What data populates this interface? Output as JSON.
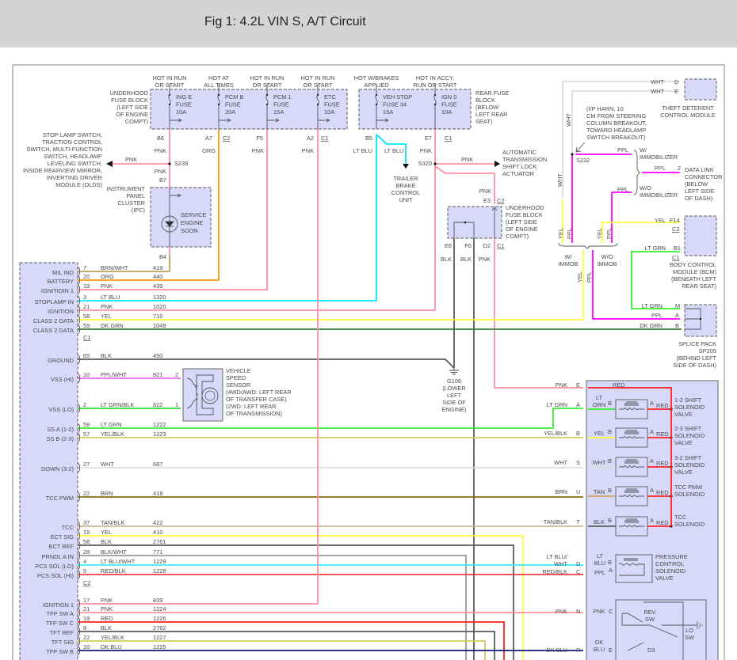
{
  "header": {
    "title": "Fig 1: 4.2L VIN S, A/T Circuit"
  },
  "wire_colors": {
    "PNK": "#ff8fa3",
    "ORG": "#ff9900",
    "BRN/WHT": "#b8a060",
    "LT BLU": "#00e5ff",
    "YEL": "#ffff33",
    "DK GRN": "#2e7d32",
    "BLK": "#5a5a5a",
    "PPL/WHT": "#ee66ee",
    "LT GRN/BLK": "#33dd33",
    "LT GRN": "#33ee33",
    "YEL/BLK": "#d4cc55",
    "WHT": "#dddddd",
    "BRN": "#8b6914",
    "TAN/BLK": "#c8b898",
    "BLK/WHT": "#999999",
    "LT BLU/WHT": "#33eeff",
    "RED/BLK": "#e84040",
    "RED": "#ff2020",
    "DK BLU": "#0a1a80",
    "PPL": "#ff00ff",
    "TAN": "#c8a060"
  },
  "pcm": {
    "connector_c1": "C1",
    "connector_c2": "C2",
    "rows": [
      {
        "label": "MIL IND",
        "pin": "7",
        "wire": "BRN/WHT",
        "circuit": "419"
      },
      {
        "label": "BATTERY",
        "pin": "20",
        "wire": "ORG",
        "circuit": "440"
      },
      {
        "label": "IGNITIOIN 1",
        "pin": "19",
        "wire": "PNK",
        "circuit": "439"
      },
      {
        "label": "STOPLAMP IN",
        "pin": "3",
        "wire": "LT BLU",
        "circuit": "1320"
      },
      {
        "label": "IGNITION",
        "pin": "21",
        "wire": "PNK",
        "circuit": "1020"
      },
      {
        "label": "CLASS 2 DATA",
        "pin": "58",
        "wire": "YEL",
        "circuit": "710"
      },
      {
        "label": "CLASS 2 DATA",
        "pin": "59",
        "wire": "DK GRN",
        "circuit": "1049"
      },
      {
        "label": "GROUND",
        "pin": "65",
        "wire": "BLK",
        "circuit": "450"
      },
      {
        "label": "VSS (HI)",
        "pin": "10",
        "wire": "PPL/WHT",
        "circuit": "821"
      },
      {
        "label": "VSS (LO)",
        "pin": "2",
        "wire": "LT GRN/BLK",
        "circuit": "822"
      },
      {
        "label": "SS A (1-2)",
        "pin": "59",
        "wire": "LT GRN",
        "circuit": "1222"
      },
      {
        "label": "SS B (2-3)",
        "pin": "57",
        "wire": "YEL/BLK",
        "circuit": "1223"
      },
      {
        "label": "DOWN (3-2)",
        "pin": "27",
        "wire": "WHT",
        "circuit": "687"
      },
      {
        "label": "TCC PWM",
        "pin": "22",
        "wire": "BRN",
        "circuit": "418"
      },
      {
        "label": "TCC",
        "pin": "37",
        "wire": "TAN/BLK",
        "circuit": "422"
      },
      {
        "label": "ECT SIG",
        "pin": "19",
        "wire": "YEL",
        "circuit": "410"
      },
      {
        "label": "ECT REF",
        "pin": "58",
        "wire": "BLK",
        "circuit": "2761"
      },
      {
        "label": "PRNDL A IN",
        "pin": "28",
        "wire": "BLK/WHT",
        "circuit": "771"
      },
      {
        "label": "PCS SOL (LO)",
        "pin": "4",
        "wire": "LT BLU/WHT",
        "circuit": "1229"
      },
      {
        "label": "PCS SOL (HI)",
        "pin": "5",
        "wire": "RED/BLK",
        "circuit": "1228"
      },
      {
        "label": "IGNITION 1",
        "pin": "17",
        "wire": "PNK",
        "circuit": "839"
      },
      {
        "label": "TFP SW A",
        "pin": "21",
        "wire": "PNK",
        "circuit": "1224"
      },
      {
        "label": "TFP SW C",
        "pin": "19",
        "wire": "RED",
        "circuit": "1226"
      },
      {
        "label": "TFT REF",
        "pin": "8",
        "wire": "BLK",
        "circuit": "2762"
      },
      {
        "label": "TFT SIG",
        "pin": "22",
        "wire": "YEL/BLK",
        "circuit": "1227"
      },
      {
        "label": "TFP SW B",
        "pin": "10",
        "wire": "DK BLU",
        "circuit": "1225"
      }
    ]
  },
  "underhood_block": {
    "location": [
      "UNDERHOOD",
      "FUSE BLOCK",
      "(LEFT SIDE",
      "OF ENGINE",
      "COMPT)"
    ],
    "fuses": [
      {
        "header": [
          "HOT IN RUN",
          "OR START"
        ],
        "lines": [
          "ING E",
          "FUSE",
          "10A"
        ],
        "pin": "B6",
        "conn": "",
        "wire": "PNK"
      },
      {
        "header": [
          "HOT AT",
          "ALL TIMES"
        ],
        "lines": [
          "PCM B",
          "FUSE",
          "20A"
        ],
        "pin": "A7",
        "conn": "C2",
        "wire": "ORG"
      },
      {
        "header": [
          "HOT IN RUN",
          "OR START"
        ],
        "lines": [
          "PCM 1",
          "FUSE",
          "15A"
        ],
        "pin": "F5",
        "conn": "",
        "wire": "PNK"
      },
      {
        "header": [
          "HOT IN RUN",
          "OR START"
        ],
        "lines": [
          "ETC",
          "FUSE",
          "10A"
        ],
        "pin": "A2",
        "conn": "C1",
        "wire": "PNK"
      }
    ]
  },
  "stoplamp_branch": {
    "target": [
      "STOP LAMP SWITCH,",
      "TRACTION CONTROL",
      "SWITCH, MULTI-FUNCTION",
      "SWITCH, HEADLAMP",
      "LEVELING SWITCH,",
      "INSIDE REARVIEW MIRROR,",
      "INVERTING DRIVER",
      "MODULE (OLDS)"
    ],
    "wire": "PNK",
    "splice": "S239",
    "wire_below": "PNK",
    "pin_in": "B7",
    "pin_out": "B4"
  },
  "ipc": {
    "name": [
      "INSTRUMENT",
      "PANEL",
      "CLUSTER",
      "(IPC)"
    ],
    "lamp": [
      "SERVICE",
      "ENGINE",
      "SOON"
    ]
  },
  "rear_block": {
    "location": [
      "REAR FUSE",
      "BLOCK",
      "(BELOW",
      "LEFT REAR",
      "SEAT)"
    ],
    "fuses": [
      {
        "header": [
          "HOT W/BRAKES",
          "APPLIED"
        ],
        "lines": [
          "VEH STOP",
          "FUSE 34",
          "15A"
        ],
        "pin": "B5",
        "wire": "LT BLU"
      },
      {
        "header": [
          "HOT IN ACCY,",
          "RUN OR START"
        ],
        "lines": [
          "IGN 0",
          "FUSE",
          "10A"
        ],
        "pin": "E7",
        "conn": "C1",
        "wire": "PNK"
      }
    ],
    "branch_wire": "LT BLU",
    "trailer": [
      "TRAILER",
      "BRAKE",
      "CONTROL",
      "UNIT"
    ],
    "splice": "S320",
    "shift_lock_wire": "PNK",
    "shift_lock": [
      "AUTOMATIC",
      "TRANSMISSION",
      "SHIFT LOCK",
      "ACTUATOR"
    ]
  },
  "underhood_block_2": {
    "in_wire": "PNK",
    "in_pin": "E3",
    "in_conn": "C2",
    "location": [
      "UNDERHOOD",
      "FUSE BLOCK",
      "(LEFT SIDE",
      "OF ENGINE",
      "COMPT)"
    ],
    "pins": [
      "E6",
      "F6",
      "D2",
      "C1"
    ],
    "wires": [
      "BLK",
      "BLK",
      "PNK"
    ]
  },
  "ground": {
    "name": [
      "G108",
      "(LOWER",
      "LEFT",
      "SIDE OF",
      "ENGINE)"
    ]
  },
  "vss": {
    "pin_hi": "2",
    "pin_lo": "1",
    "name": [
      "VEHICLE",
      "SPEED",
      "SENSOR",
      "(4WD/AWD: LEFT REAR",
      "OF TRANSFER CASE)",
      "(2WD: LEFT REAR",
      "OF TRANSMISSION)"
    ]
  },
  "theft": {
    "wires": [
      {
        "wire": "WHT",
        "pin": "D"
      },
      {
        "wire": "WHT",
        "pin": "E"
      }
    ],
    "name": [
      "THEFT DETERENT",
      "CONTROL MODULE"
    ],
    "vertical_wire": "WHT"
  },
  "s232": {
    "note": [
      "(I/P HARN, 10",
      "CM FROM STEERING",
      "COLUMN BREAKOUT,",
      "TOWARD HEADLAMP",
      "SWITCH BREAKOUT)"
    ],
    "splice": "S232",
    "wire": "PPL",
    "w_immob": [
      "W/",
      "IMMOBILIZER"
    ],
    "wo_immob": [
      "W/O",
      "IMMOBILIZER"
    ],
    "dlc_wire": "PPL",
    "dlc_pin": "2",
    "dlc": [
      "DATA LINK",
      "CONNECTOR",
      "(BELOW",
      "LEFT SIDE",
      "OF DASH)"
    ],
    "wo_wire": "PPL",
    "vert": [
      "YEL",
      "PPL",
      "YEL",
      "PPL",
      "YEL",
      "PPL"
    ],
    "w_immob_short": [
      "W/",
      "IMMOB"
    ],
    "wo_immob_short": [
      "W/O",
      "IMMOB"
    ]
  },
  "bcm": {
    "wire1": "YEL",
    "pin1": "F14",
    "conn1": "C2",
    "wire2": "LT GRN",
    "pin2": "B1",
    "conn2": "C1",
    "name": [
      "BODY CONTROL",
      "MODULE (BCM)",
      "(BENEATH LEFT",
      "REAR SEAT)"
    ]
  },
  "splice_pack": {
    "pins": [
      {
        "wire": "LT GRN",
        "pin": "M"
      },
      {
        "wire": "PPL",
        "pin": "A"
      },
      {
        "wire": "DK GRN",
        "pin": "B"
      }
    ],
    "name": [
      "SPLICE PACK",
      "SP205",
      "(BEHIND LEFT",
      "SIDE OF DASH)"
    ]
  },
  "trans": {
    "feed": {
      "wire": "PNK",
      "pin": "E",
      "inner": "RED"
    },
    "solenoids": [
      {
        "outer_wire": "LT GRN",
        "pin": "A",
        "inner": [
          "LT",
          "GRN"
        ],
        "b": "B",
        "a": "A",
        "out": "RED",
        "name": [
          "1-2 SHIFT",
          "SOLENOID",
          "VALVE"
        ]
      },
      {
        "outer_wire": "YEL/BLK",
        "pin": "B",
        "inner": [
          "YEL"
        ],
        "b": "B",
        "a": "A",
        "out": "RED",
        "name": [
          "2-3 SHIFT",
          "SOLENOID",
          "VALVE"
        ]
      },
      {
        "outer_wire": "WHT",
        "pin": "S",
        "inner": [
          "WHT"
        ],
        "b": "B",
        "a": "A",
        "out": "RED",
        "name": [
          "3-2 SHIFT",
          "SOLENOID",
          "VALVE"
        ]
      },
      {
        "outer_wire": "BRN",
        "pin": "U",
        "inner": [
          "TAN"
        ],
        "b": "B",
        "a": "A",
        "out": "RED",
        "name": [
          "TCC PMW",
          "SOLENOID"
        ]
      },
      {
        "outer_wire": "TAN/BLK",
        "pin": "T",
        "inner": [
          "BLK"
        ],
        "b": "B",
        "a": "A",
        "out": "RED",
        "name": [
          "TCC",
          "SOLENOID"
        ]
      }
    ],
    "pcs": {
      "d_wire": [
        "LT BLU/",
        "WHT"
      ],
      "d_pin": "D",
      "d_inner": [
        "LT",
        "BLU"
      ],
      "d_b": "B",
      "c_wire": "RED/BLK",
      "c_pin": "C",
      "c_inner": "PPL",
      "c_a": "A",
      "name": [
        "PRESSURE",
        "CONTROL",
        "SOLENOID",
        "VALVE"
      ]
    },
    "tfp": {
      "n_wire": "PNK",
      "n_pin": "N",
      "n_inner": "PNK",
      "n_c": "C",
      "r_wire": "DK BLU",
      "r_pin": "R",
      "r_inner": [
        "DK",
        "BLU"
      ],
      "r_e": "E",
      "rev": [
        "REV",
        "SW"
      ],
      "lo": [
        "LO",
        "SW"
      ],
      "d3": "D3"
    }
  }
}
